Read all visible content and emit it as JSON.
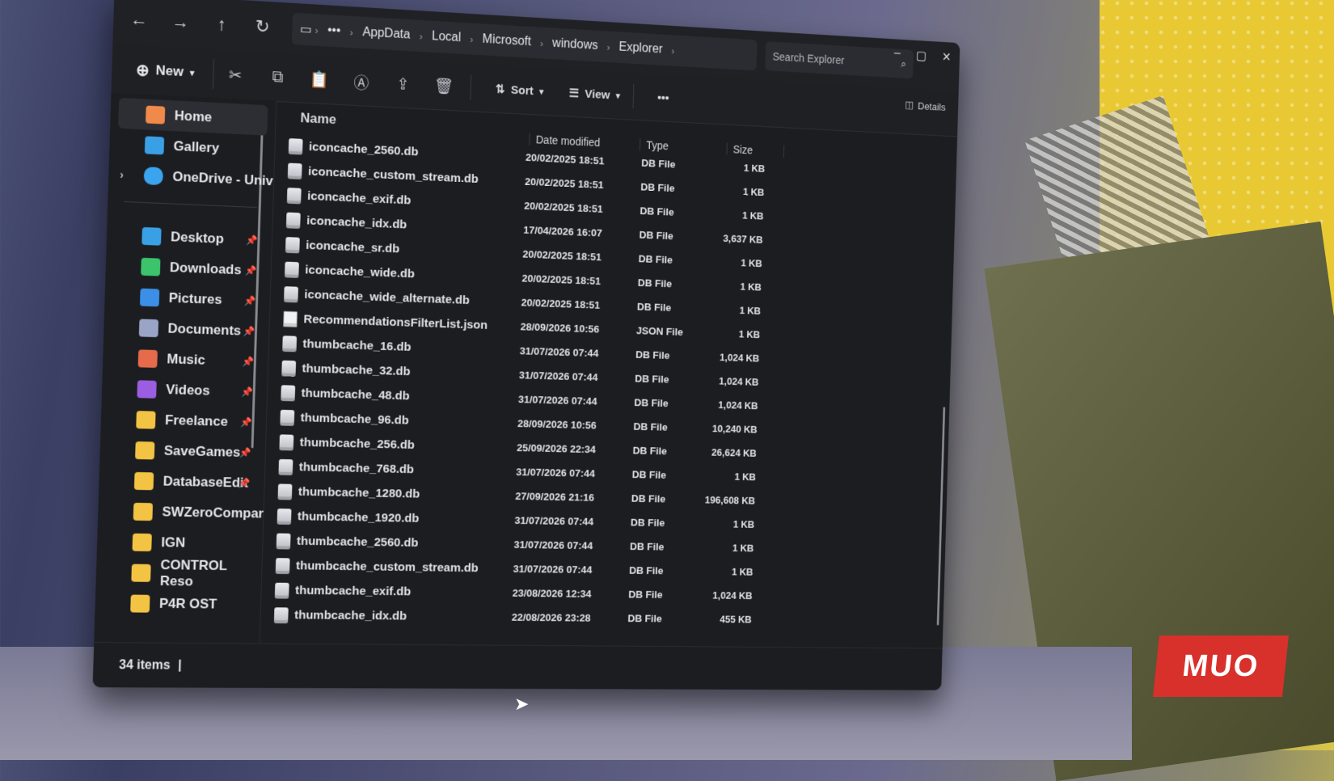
{
  "toolbar": {
    "new_label": "New",
    "sort_label": "Sort",
    "view_label": "View",
    "more_label": "•••",
    "details_label": "Details"
  },
  "address": {
    "crumbs": [
      "AppData",
      "Local",
      "Microsoft",
      "windows",
      "Explorer"
    ],
    "ellipsis": "•••"
  },
  "search": {
    "placeholder": "Search Explorer"
  },
  "sidebar": {
    "home": "Home",
    "gallery": "Gallery",
    "onedrive": "OneDrive - Univ",
    "items": [
      {
        "label": "Desktop",
        "color": "#3aa0e6"
      },
      {
        "label": "Downloads",
        "color": "#3bc46b"
      },
      {
        "label": "Pictures",
        "color": "#3b8fe6"
      },
      {
        "label": "Documents",
        "color": "#9aa4c6"
      },
      {
        "label": "Music",
        "color": "#e56b4a"
      },
      {
        "label": "Videos",
        "color": "#9b5ee0"
      },
      {
        "label": "Freelance",
        "color": "#f3c443"
      },
      {
        "label": "SaveGames",
        "color": "#f3c443"
      },
      {
        "label": "DatabaseEdit",
        "color": "#f3c443"
      },
      {
        "label": "SWZeroCompar",
        "color": "#f3c443"
      },
      {
        "label": "IGN",
        "color": "#f3c443"
      },
      {
        "label": "CONTROL Reso",
        "color": "#f3c443"
      },
      {
        "label": "P4R OST",
        "color": "#f3c443"
      }
    ]
  },
  "columns": {
    "name": "Name",
    "date": "Date modified",
    "type": "Type",
    "size": "Size"
  },
  "files": [
    {
      "name": "iconcache_2560.db",
      "date": "20/02/2025 18:51",
      "type": "DB File",
      "size": "1 KB"
    },
    {
      "name": "iconcache_custom_stream.db",
      "date": "20/02/2025 18:51",
      "type": "DB File",
      "size": "1 KB"
    },
    {
      "name": "iconcache_exif.db",
      "date": "20/02/2025 18:51",
      "type": "DB File",
      "size": "1 KB"
    },
    {
      "name": "iconcache_idx.db",
      "date": "17/04/2026 16:07",
      "type": "DB File",
      "size": "3,637 KB"
    },
    {
      "name": "iconcache_sr.db",
      "date": "20/02/2025 18:51",
      "type": "DB File",
      "size": "1 KB"
    },
    {
      "name": "iconcache_wide.db",
      "date": "20/02/2025 18:51",
      "type": "DB File",
      "size": "1 KB"
    },
    {
      "name": "iconcache_wide_alternate.db",
      "date": "20/02/2025 18:51",
      "type": "DB File",
      "size": "1 KB"
    },
    {
      "name": "RecommendationsFilterList.json",
      "date": "28/09/2026 10:56",
      "type": "JSON File",
      "size": "1 KB"
    },
    {
      "name": "thumbcache_16.db",
      "date": "31/07/2026 07:44",
      "type": "DB File",
      "size": "1,024 KB"
    },
    {
      "name": "thumbcache_32.db",
      "date": "31/07/2026 07:44",
      "type": "DB File",
      "size": "1,024 KB"
    },
    {
      "name": "thumbcache_48.db",
      "date": "31/07/2026 07:44",
      "type": "DB File",
      "size": "1,024 KB"
    },
    {
      "name": "thumbcache_96.db",
      "date": "28/09/2026 10:56",
      "type": "DB File",
      "size": "10,240 KB"
    },
    {
      "name": "thumbcache_256.db",
      "date": "25/09/2026 22:34",
      "type": "DB File",
      "size": "26,624 KB"
    },
    {
      "name": "thumbcache_768.db",
      "date": "31/07/2026 07:44",
      "type": "DB File",
      "size": "1 KB"
    },
    {
      "name": "thumbcache_1280.db",
      "date": "27/09/2026 21:16",
      "type": "DB File",
      "size": "196,608 KB"
    },
    {
      "name": "thumbcache_1920.db",
      "date": "31/07/2026 07:44",
      "type": "DB File",
      "size": "1 KB"
    },
    {
      "name": "thumbcache_2560.db",
      "date": "31/07/2026 07:44",
      "type": "DB File",
      "size": "1 KB"
    },
    {
      "name": "thumbcache_custom_stream.db",
      "date": "31/07/2026 07:44",
      "type": "DB File",
      "size": "1 KB"
    },
    {
      "name": "thumbcache_exif.db",
      "date": "23/08/2026 12:34",
      "type": "DB File",
      "size": "1,024 KB"
    },
    {
      "name": "thumbcache_idx.db",
      "date": "22/08/2026 23:28",
      "type": "DB File",
      "size": "455 KB"
    }
  ],
  "status": {
    "item_count": "34 items"
  },
  "watermark": {
    "text": "MUO",
    "color": "#d8302b"
  }
}
